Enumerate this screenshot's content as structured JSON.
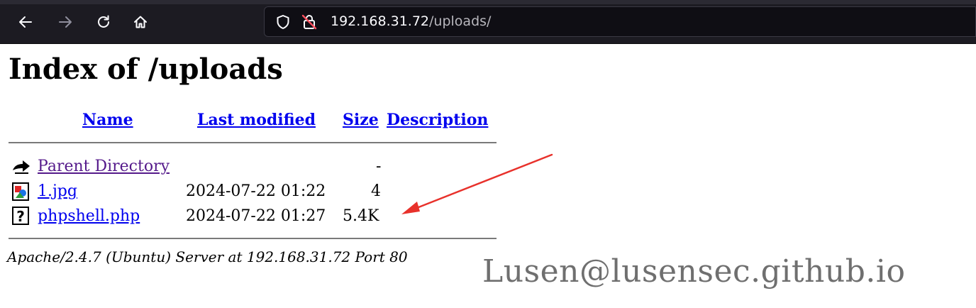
{
  "browser": {
    "url_host": "192.168.31.72",
    "url_path": "/uploads/"
  },
  "page": {
    "title": "Index of /uploads",
    "columns": {
      "name": "Name",
      "last_modified": "Last modified",
      "size": "Size",
      "description": "Description"
    },
    "rows": [
      {
        "icon": "back-icon",
        "name": "Parent Directory",
        "last_modified": "",
        "size": "-",
        "description": ""
      },
      {
        "icon": "image-file-icon",
        "name": "1.jpg",
        "last_modified": "2024-07-22 01:22",
        "size": "4",
        "description": ""
      },
      {
        "icon": "unknown-file-icon",
        "name": "phpshell.php",
        "last_modified": "2024-07-22 01:27",
        "size": "5.4K",
        "description": ""
      }
    ],
    "server_signature": "Apache/2.4.7 (Ubuntu) Server at 192.168.31.72 Port 80"
  },
  "overlay": {
    "watermark": "Lusen@lusensec.github.io",
    "arrow_color": "#e8312b"
  }
}
